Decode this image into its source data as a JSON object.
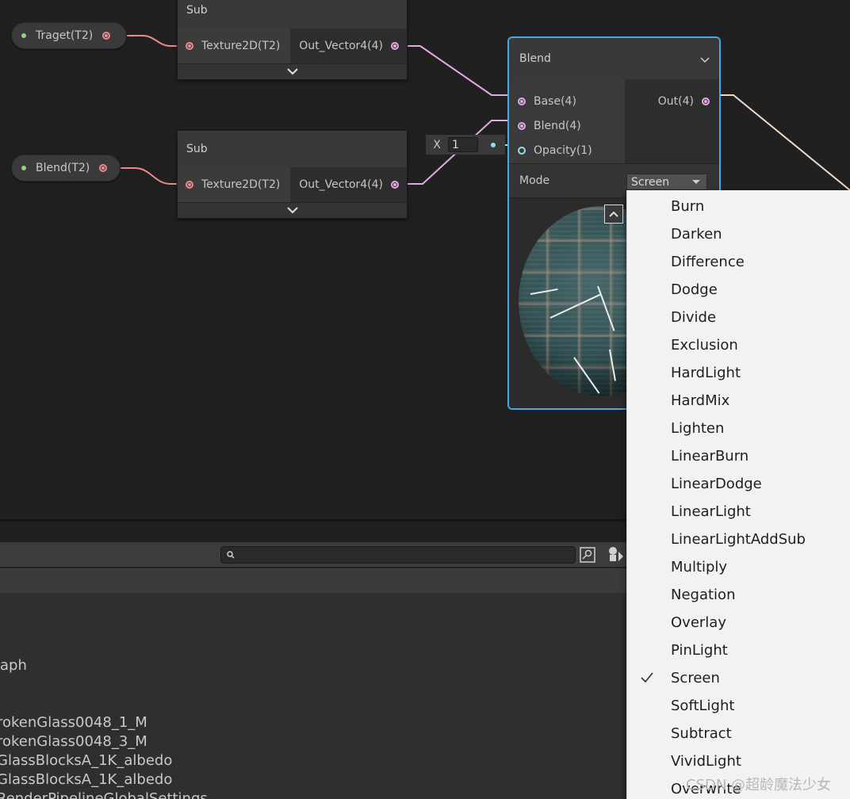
{
  "properties": {
    "target": "Traget(T2)",
    "blend": "Blend(T2)"
  },
  "sub_nodes": [
    {
      "title": "Sub",
      "input": "Texture2D(T2)",
      "output": "Out_Vector4(4)"
    },
    {
      "title": "Sub",
      "input": "Texture2D(T2)",
      "output": "Out_Vector4(4)"
    }
  ],
  "blend_node": {
    "title": "Blend",
    "inputs": [
      "Base(4)",
      "Blend(4)",
      "Opacity(1)"
    ],
    "output": "Out(4)",
    "mode_label": "Mode",
    "mode_value": "Screen"
  },
  "opacity_field": {
    "label": "X",
    "value": "1"
  },
  "asset_panel": {
    "items": [
      "aph",
      "rokenGlass0048_1_M",
      "rokenGlass0048_3_M",
      "GlassBlocksA_1K_albedo",
      "GlassBlocksA_1K_albedo",
      "RenderPipelineGlobalSettings"
    ]
  },
  "mode_dropdown": {
    "options": [
      "Burn",
      "Darken",
      "Difference",
      "Dodge",
      "Divide",
      "Exclusion",
      "HardLight",
      "HardMix",
      "Lighten",
      "LinearBurn",
      "LinearDodge",
      "LinearLight",
      "LinearLightAddSub",
      "Multiply",
      "Negation",
      "Overlay",
      "PinLight",
      "Screen",
      "SoftLight",
      "Subtract",
      "VividLight",
      "Overwrite"
    ],
    "selected": "Screen"
  },
  "watermark": "CSDN @超龄魔法少女",
  "colors": {
    "canvas": "#202020",
    "selection_border": "#44a9e8",
    "wire_texture": "#ec8a8a",
    "wire_vector": "#e3a9e3",
    "wire_float": "#8fe0e8"
  },
  "icons": {
    "chevron": "chevron-down-icon",
    "search": "search-icon",
    "check": "check-icon"
  }
}
